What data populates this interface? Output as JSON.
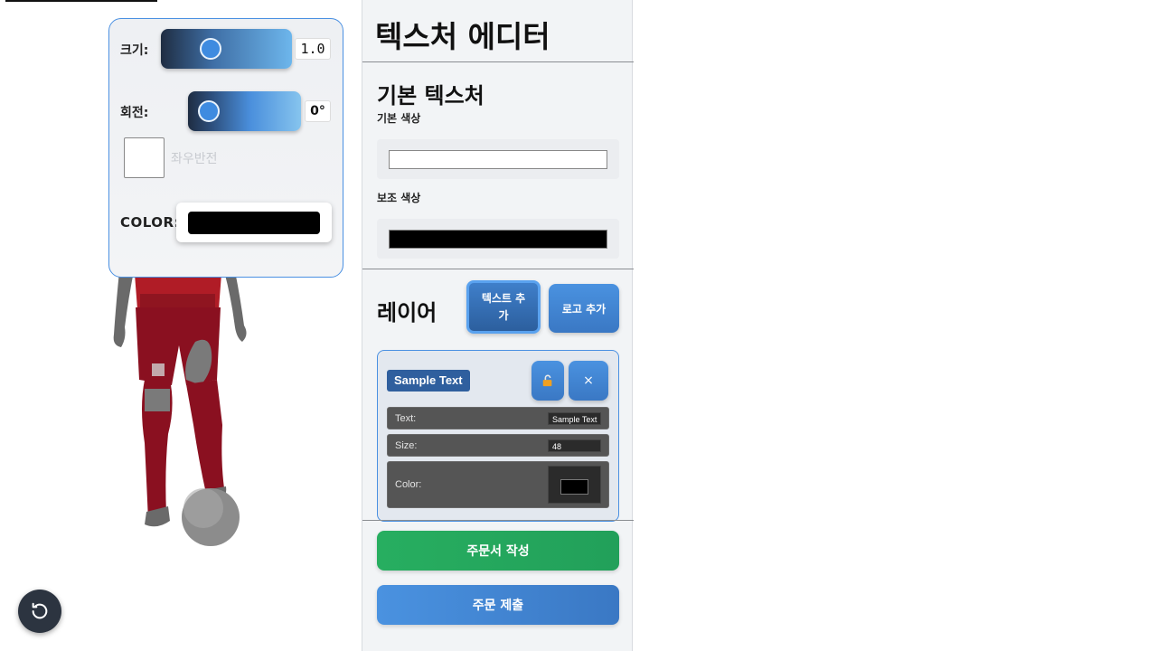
{
  "viewport": {
    "scale_label": "크기:",
    "scale_value": "1.0",
    "rotation_label": "회전:",
    "rotation_value": "0°",
    "mirror_label": "좌우반전",
    "color_label": "COLOR:",
    "color_value": "#000000",
    "reset_icon": "rotate-ccw-icon"
  },
  "editor": {
    "title": "텍스처 에디터",
    "base_texture": {
      "title": "기본 텍스처",
      "primary_color_label": "기본 색상",
      "primary_color": "#ffffff",
      "secondary_color_label": "보조 색상",
      "secondary_color": "#000000"
    },
    "layers": {
      "title": "레이어",
      "add_text_label": "텍스트 추가",
      "add_logo_label": "로고 추가",
      "items": [
        {
          "name": "Sample Text",
          "lock_icon": "unlock-icon",
          "delete_label": "×",
          "text_label": "Text:",
          "text_value": "Sample Text",
          "size_label": "Size:",
          "size_value": "48",
          "color_label": "Color:",
          "color_value": "#000000"
        }
      ]
    },
    "create_order_label": "주문서 작성",
    "submit_order_label": "주문 제출"
  }
}
